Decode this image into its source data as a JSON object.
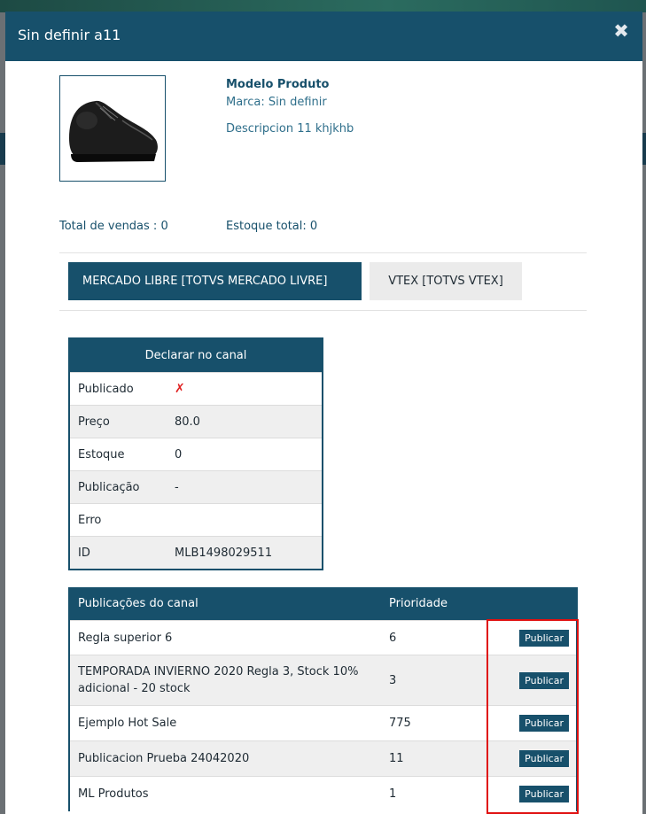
{
  "modal": {
    "title": "Sin definir a11",
    "close_icon": "close-icon"
  },
  "product": {
    "image_icon": "shoe-image",
    "model": "Modelo Produto",
    "brand": "Marca: Sin definir",
    "description": "Descripcion 11 khjkhb",
    "total_sales": "Total de vendas : 0",
    "total_stock": "Estoque total: 0"
  },
  "tabs": [
    {
      "label": "MERCADO LIBRE [TOTVS MERCADO LIVRE]",
      "active": true
    },
    {
      "label": "VTEX [TOTVS VTEX]",
      "active": false
    }
  ],
  "declare": {
    "header": "Declarar no canal",
    "rows": [
      {
        "label": "Publicado",
        "value": "✗"
      },
      {
        "label": "Preço",
        "value": "80.0"
      },
      {
        "label": "Estoque",
        "value": "0"
      },
      {
        "label": "Publicação",
        "value": "-"
      },
      {
        "label": "Erro",
        "value": ""
      },
      {
        "label": "ID",
        "value": "MLB1498029511"
      }
    ]
  },
  "publications": {
    "headers": [
      "Publicações do canal",
      "Prioridade",
      ""
    ],
    "button_label": "Publicar",
    "rows": [
      {
        "name": "Regla superior 6",
        "priority": "6"
      },
      {
        "name": "TEMPORADA INVIERNO 2020 Regla 3, Stock 10% adicional - 20 stock",
        "priority": "3"
      },
      {
        "name": "Ejemplo Hot Sale",
        "priority": "775"
      },
      {
        "name": "Publicacion Prueba 24042020",
        "priority": "11"
      },
      {
        "name": "ML Produtos",
        "priority": "1"
      }
    ]
  },
  "colors": {
    "primary": "#17506b",
    "highlight": "#e01010",
    "unpublished_mark": "#e02020"
  }
}
